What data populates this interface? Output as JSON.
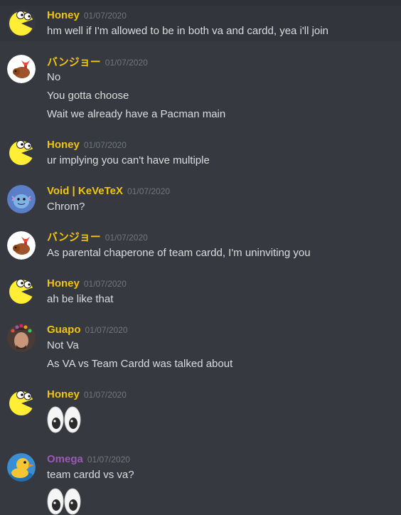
{
  "colors": {
    "background": "#36393f",
    "honey": "#f1c40f",
    "banjo": "#f1c40f",
    "void": "#f1c40f",
    "guapo": "#f1c40f",
    "omega": "#9b59b6",
    "timestamp": "#72767d",
    "text": "#dcddde"
  },
  "messages": [
    {
      "author": "Honey",
      "avatar": "pacman-avatar-icon",
      "timestamp": "01/07/2020",
      "lines": [
        "hm well if I'm allowed to be in both va and cardd, yea i'll join"
      ]
    },
    {
      "author": "バンジョー",
      "avatar": "banjo-avatar-icon",
      "timestamp": "01/07/2020",
      "lines": [
        "No",
        "You gotta choose",
        "Wait we already have a Pacman main"
      ]
    },
    {
      "author": "Honey",
      "avatar": "pacman-avatar-icon",
      "timestamp": "01/07/2020",
      "lines": [
        "ur implying you can't have multiple"
      ]
    },
    {
      "author": "Void | KeVeTeX",
      "avatar": "wooper-avatar-icon",
      "timestamp": "01/07/2020",
      "lines": [
        "Chrom?"
      ]
    },
    {
      "author": "バンジョー",
      "avatar": "banjo-avatar-icon",
      "timestamp": "01/07/2020",
      "lines": [
        "As parental chaperone of team cardd, I'm uninviting you"
      ]
    },
    {
      "author": "Honey",
      "avatar": "pacman-avatar-icon",
      "timestamp": "01/07/2020",
      "lines": [
        "ah be like that"
      ]
    },
    {
      "author": "Guapo",
      "avatar": "guapo-avatar-icon",
      "timestamp": "01/07/2020",
      "lines": [
        "Not Va",
        "As VA vs Team Cardd was talked about"
      ]
    },
    {
      "author": "Honey",
      "avatar": "pacman-avatar-icon",
      "timestamp": "01/07/2020",
      "emoji": "eyes-emoji-icon"
    },
    {
      "author": "Omega",
      "avatar": "duck-avatar-icon",
      "timestamp": "01/07/2020",
      "lines": [
        "team cardd vs va?"
      ],
      "emoji": "eyes-emoji-icon"
    }
  ]
}
